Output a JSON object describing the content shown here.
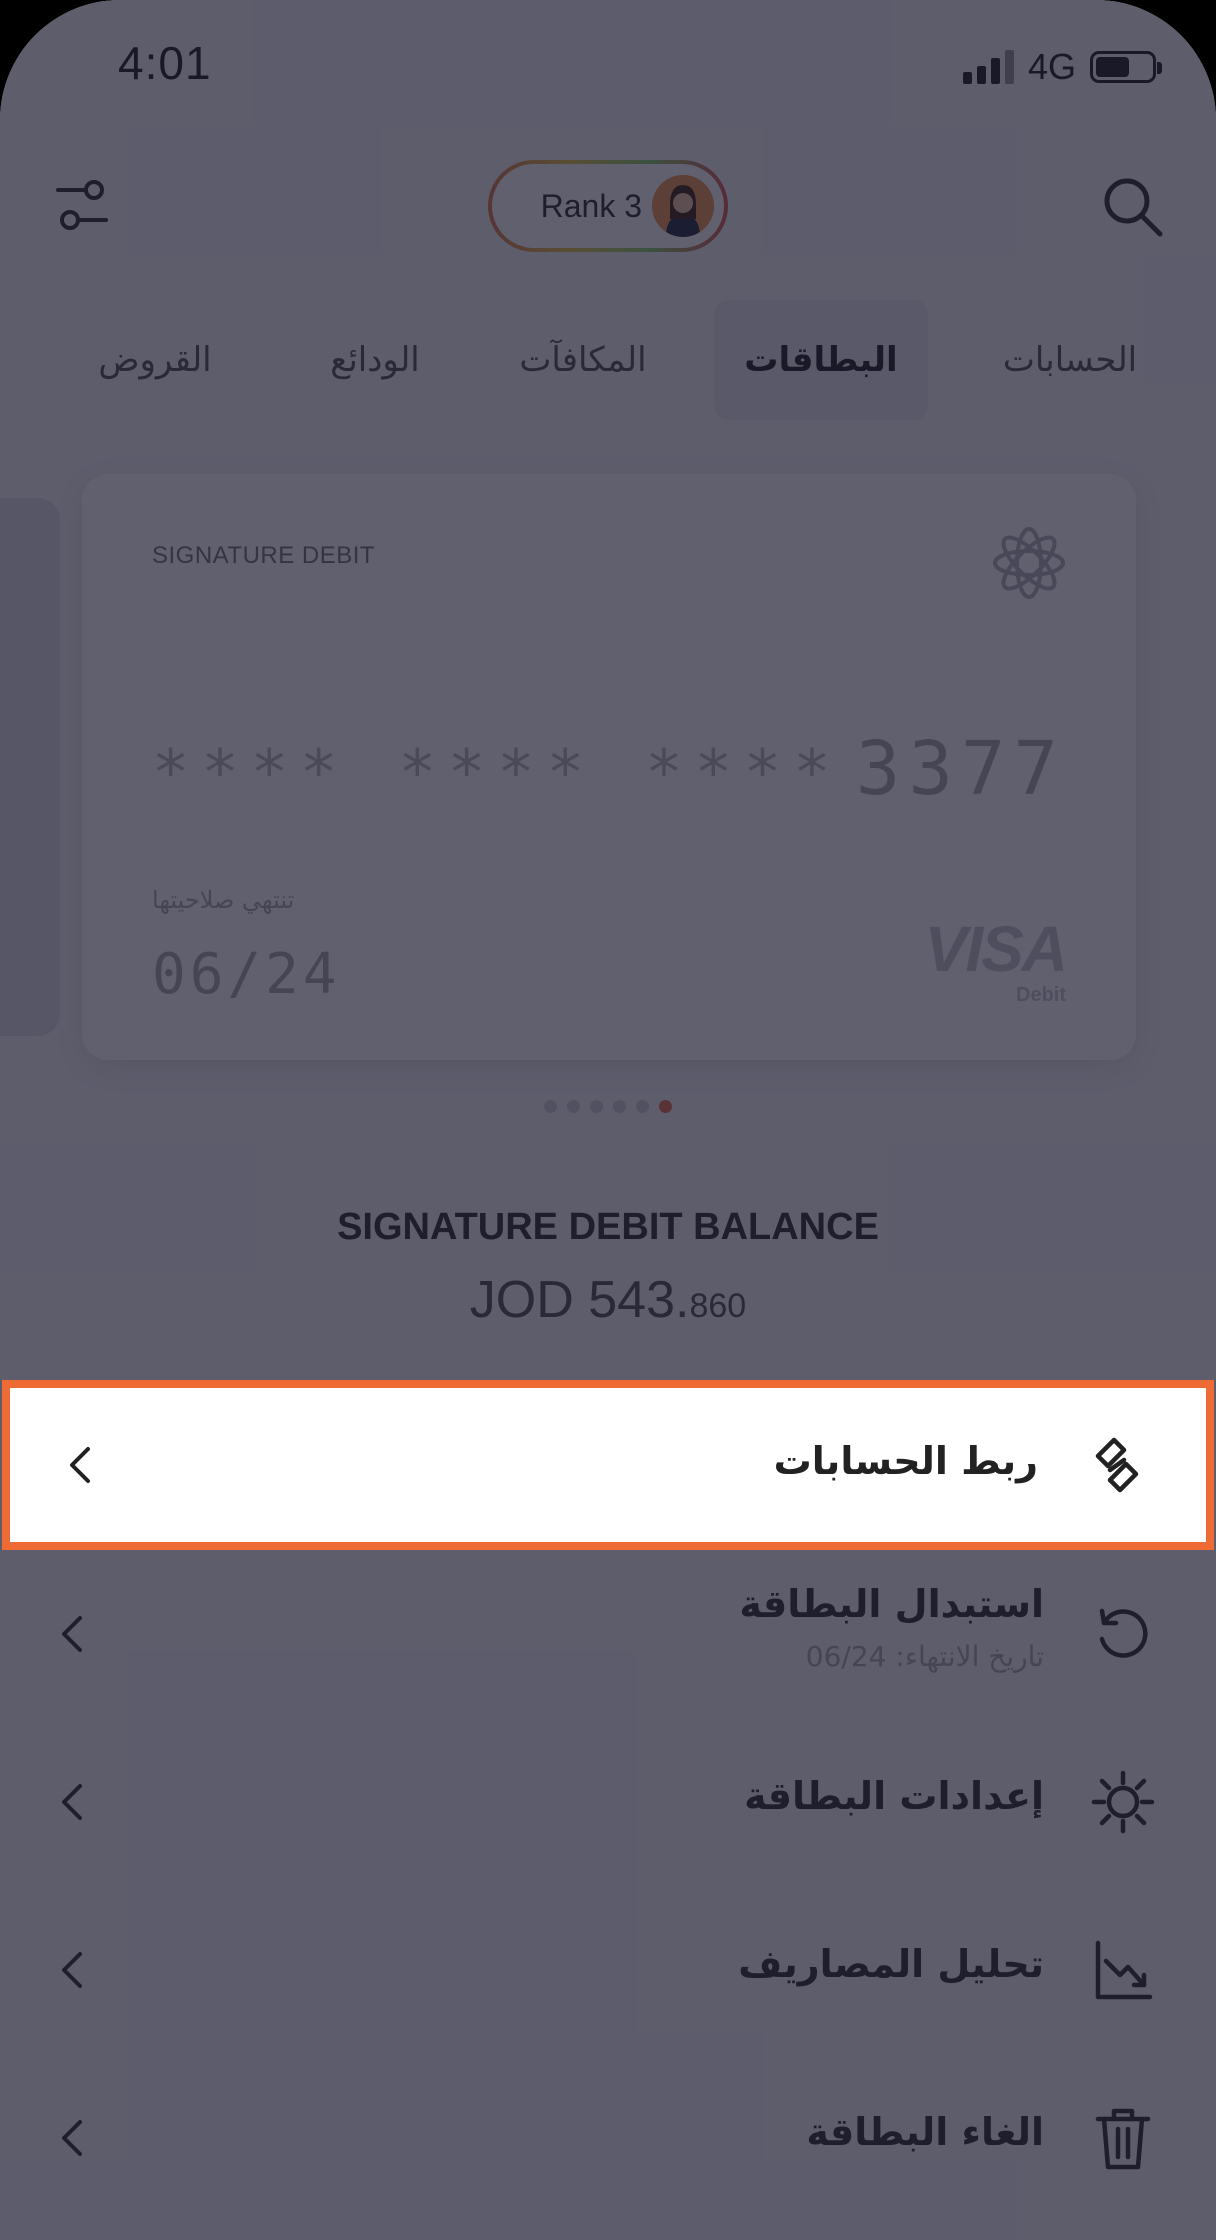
{
  "status_bar": {
    "time": "4:01",
    "network": "4G"
  },
  "header": {
    "rank_label": "Rank 3"
  },
  "tabs": [
    {
      "label": "الحسابات"
    },
    {
      "label": "البطاقات",
      "active": true
    },
    {
      "label": "المكافآت"
    },
    {
      "label": "الودائع"
    },
    {
      "label": "القروض"
    }
  ],
  "card": {
    "type": "SIGNATURE DEBIT",
    "masked_number": "**** **** ****",
    "last4": "3377",
    "expiry_label": "تنتهي صلاحيتها",
    "expiry": "06/24",
    "brand": "VISA",
    "brand_sub": "Debit"
  },
  "pager": {
    "count": 6,
    "active_index": 5
  },
  "balance": {
    "title": "SIGNATURE DEBIT BALANCE",
    "currency_main": "JOD 543.",
    "decimals": "860"
  },
  "menu": [
    {
      "label": "ربط الحسابات",
      "icon": "link-icon",
      "highlighted": true
    },
    {
      "label": "استبدال البطاقة",
      "sublabel": "تاريخ الانتهاء: 06/24",
      "icon": "refresh-icon"
    },
    {
      "label": "إعدادات البطاقة",
      "icon": "gear-icon"
    },
    {
      "label": "تحليل المصاريف",
      "icon": "chart-icon"
    },
    {
      "label": "الغاء البطاقة",
      "icon": "trash-icon"
    }
  ],
  "colors": {
    "highlight_border": "#ef6b35",
    "pager_active": "#e8744c",
    "overlay": "#14142a"
  }
}
